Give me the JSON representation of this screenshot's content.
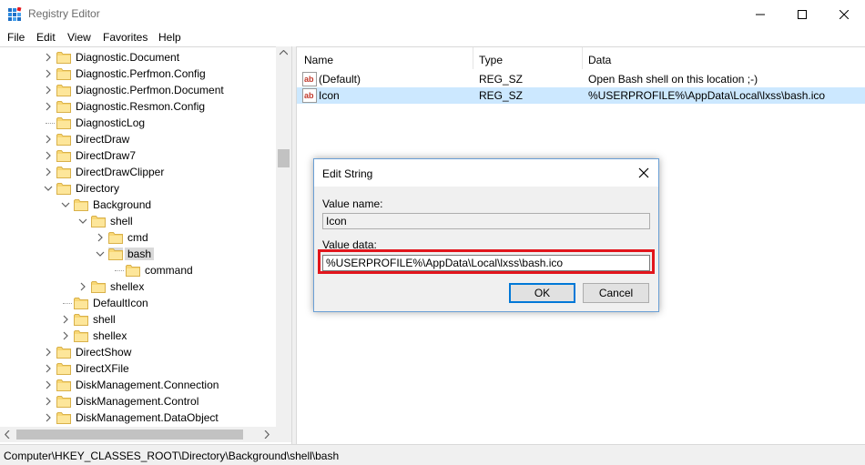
{
  "window": {
    "title": "Registry Editor"
  },
  "menu": [
    "File",
    "Edit",
    "View",
    "Favorites",
    "Help"
  ],
  "tree": [
    {
      "label": "Diagnostic.Document",
      "depth": 0,
      "chevron": "right"
    },
    {
      "label": "Diagnostic.Perfmon.Config",
      "depth": 0,
      "chevron": "right"
    },
    {
      "label": "Diagnostic.Perfmon.Document",
      "depth": 0,
      "chevron": "right"
    },
    {
      "label": "Diagnostic.Resmon.Config",
      "depth": 0,
      "chevron": "right"
    },
    {
      "label": "DiagnosticLog",
      "depth": 0,
      "chevron": "none"
    },
    {
      "label": "DirectDraw",
      "depth": 0,
      "chevron": "right"
    },
    {
      "label": "DirectDraw7",
      "depth": 0,
      "chevron": "right"
    },
    {
      "label": "DirectDrawClipper",
      "depth": 0,
      "chevron": "right"
    },
    {
      "label": "Directory",
      "depth": 0,
      "chevron": "down"
    },
    {
      "label": "Background",
      "depth": 1,
      "chevron": "down"
    },
    {
      "label": "shell",
      "depth": 2,
      "chevron": "down"
    },
    {
      "label": "cmd",
      "depth": 3,
      "chevron": "right"
    },
    {
      "label": "bash",
      "depth": 3,
      "chevron": "down",
      "selected": true
    },
    {
      "label": "command",
      "depth": 4,
      "chevron": "none"
    },
    {
      "label": "shellex",
      "depth": 2,
      "chevron": "right"
    },
    {
      "label": "DefaultIcon",
      "depth": 1,
      "chevron": "none"
    },
    {
      "label": "shell",
      "depth": 1,
      "chevron": "right"
    },
    {
      "label": "shellex",
      "depth": 1,
      "chevron": "right"
    },
    {
      "label": "DirectShow",
      "depth": 0,
      "chevron": "right"
    },
    {
      "label": "DirectXFile",
      "depth": 0,
      "chevron": "right"
    },
    {
      "label": "DiskManagement.Connection",
      "depth": 0,
      "chevron": "right"
    },
    {
      "label": "DiskManagement.Control",
      "depth": 0,
      "chevron": "right"
    },
    {
      "label": "DiskManagement.DataObject",
      "depth": 0,
      "chevron": "right"
    }
  ],
  "list": {
    "columns": [
      "Name",
      "Type",
      "Data"
    ],
    "rows": [
      {
        "name": "(Default)",
        "type": "REG_SZ",
        "data": "Open Bash shell on this location ;-)",
        "icon": "string-value-icon"
      },
      {
        "name": "Icon",
        "type": "REG_SZ",
        "data": "%USERPROFILE%\\AppData\\Local\\lxss\\bash.ico",
        "icon": "string-value-icon",
        "selected": true
      }
    ]
  },
  "status": {
    "path": "Computer\\HKEY_CLASSES_ROOT\\Directory\\Background\\shell\\bash"
  },
  "dialog": {
    "title": "Edit String",
    "value_name_label": "Value name:",
    "value_name": "Icon",
    "value_data_label": "Value data:",
    "value_data": "%USERPROFILE%\\AppData\\Local\\lxss\\bash.ico",
    "ok_label": "OK",
    "cancel_label": "Cancel"
  },
  "colors": {
    "highlight": "#e2151c",
    "selection": "#cce8ff",
    "folder": "#f8d775",
    "accent": "#0078d7"
  }
}
